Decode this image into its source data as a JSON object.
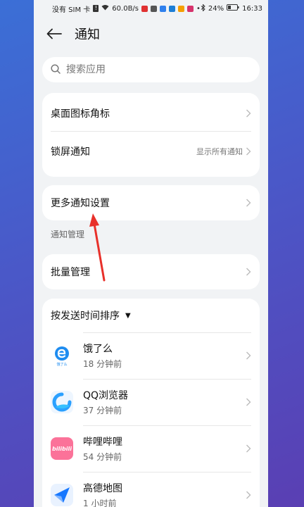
{
  "status_bar": {
    "sim": "没有 SIM 卡",
    "speed": "60.0B/s",
    "battery": "24%",
    "time": "16:33"
  },
  "header": {
    "title": "通知"
  },
  "search": {
    "placeholder": "搜索应用"
  },
  "group1": {
    "badge_label": "桌面图标角标",
    "lockscreen_label": "锁屏通知",
    "lockscreen_value": "显示所有通知"
  },
  "group2": {
    "more_label": "更多通知设置"
  },
  "section": {
    "manage_title": "通知管理"
  },
  "group3": {
    "batch_label": "批量管理"
  },
  "apps_card": {
    "sort_label": "按发送时间排序",
    "apps": [
      {
        "name": "饿了么",
        "time": "18 分钟前",
        "icon": "eleme-icon",
        "icon_color": "#1e8cf0",
        "icon_text": "饿了么"
      },
      {
        "name": "QQ浏览器",
        "time": "37 分钟前",
        "icon": "qq-browser-icon",
        "icon_color": "#2aa0ff"
      },
      {
        "name": "哔哩哔哩",
        "time": "54 分钟前",
        "icon": "bilibili-icon",
        "icon_color": "#fb7299",
        "icon_text": "bilibili"
      },
      {
        "name": "高德地图",
        "time": "1 小时前",
        "icon": "amap-icon",
        "icon_color": "#1677ff"
      }
    ]
  }
}
